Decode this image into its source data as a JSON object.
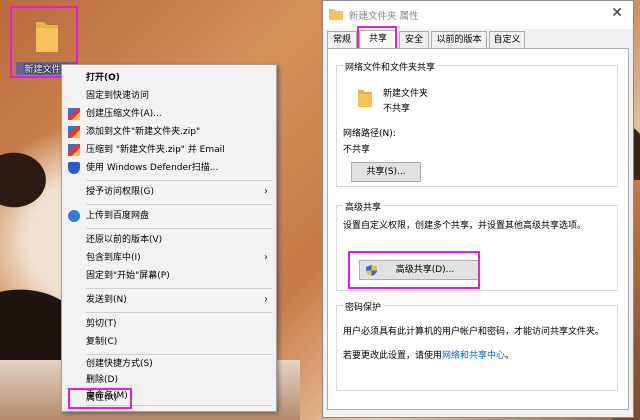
{
  "desktop": {
    "icon_label": "新建文件夹"
  },
  "context_menu": {
    "items": [
      {
        "label": "打开(O)",
        "bold": true
      },
      {
        "label": "固定到快速访问"
      },
      {
        "label": "创建压缩文件(A)..."
      },
      {
        "label": "添加到文件\"新建文件夹.zip\""
      },
      {
        "label": "压缩到 \"新建文件夹.zip\" 并 Email"
      },
      {
        "label": "使用 Windows Defender扫描..."
      },
      {
        "label": "授予访问权限(G)"
      },
      {
        "label": "上传到百度网盘"
      },
      {
        "label": "还原以前的版本(V)"
      },
      {
        "label": "包含到库中(I)"
      },
      {
        "label": "固定到\"开始\"屏幕(P)"
      },
      {
        "label": "发送到(N)"
      },
      {
        "label": "剪切(T)"
      },
      {
        "label": "复制(C)"
      },
      {
        "label": "创建快捷方式(S)"
      },
      {
        "label": "删除(D)"
      },
      {
        "label": "重命名(M)"
      },
      {
        "label": "属性(R)"
      }
    ]
  },
  "properties_window": {
    "title": "新建文件夹 属性",
    "close_glyph": "✕",
    "tabs": [
      "常规",
      "共享",
      "安全",
      "以前的版本",
      "自定义"
    ],
    "active_tab": "共享",
    "network_sharing": {
      "title": "网络文件和文件夹共享",
      "folder_name": "新建文件夹",
      "status": "不共享",
      "path_label": "网络路径(N):",
      "path_value": "不共享",
      "share_button": "共享(S)..."
    },
    "advanced_sharing": {
      "title": "高级共享",
      "description": "设置自定义权限，创建多个共享，并设置其他高级共享选项。",
      "button": "高级共享(D)..."
    },
    "password_protection": {
      "title": "密码保护",
      "description": "用户必须具有此计算机的用户帐户和密码，才能访问共享文件夹。",
      "change_prefix": "若要更改此设置，请使用",
      "change_link": "网络和共享中心",
      "change_suffix": "。"
    }
  },
  "colors": {
    "highlight": "#e81ed4",
    "link": "#0066cc",
    "folder": "#f4c45a"
  },
  "icons": [
    "folder-icon",
    "archive-icon",
    "shield-icon",
    "cloud-icon",
    "share-shield-icon",
    "chevron-right-icon",
    "close-icon"
  ]
}
